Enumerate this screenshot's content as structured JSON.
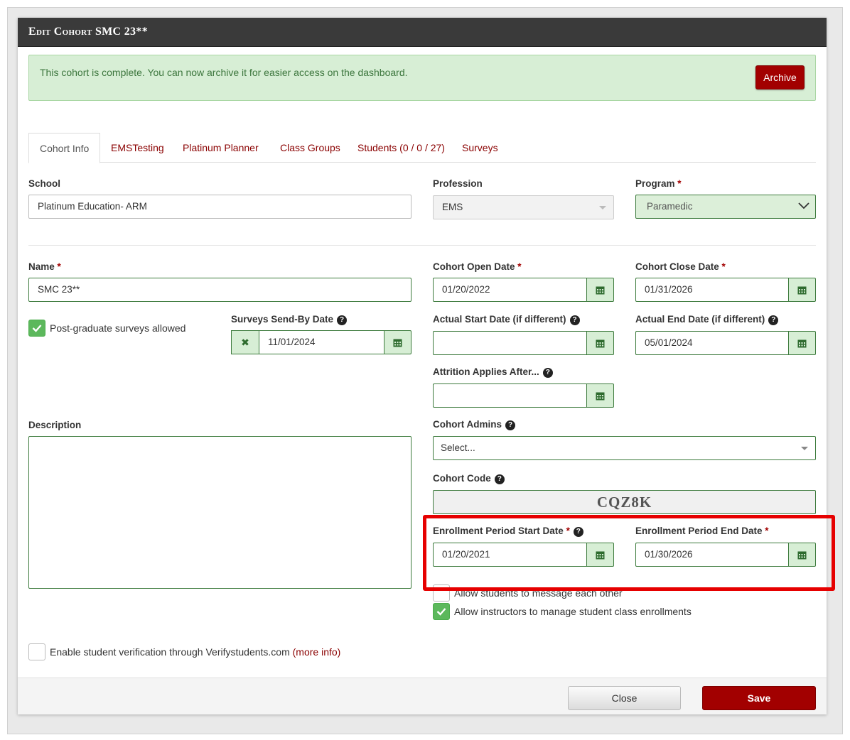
{
  "modal": {
    "title": "Edit Cohort SMC 23**"
  },
  "alert": {
    "message": "This cohort is complete. You can now archive it for easier access on the dashboard.",
    "archive_label": "Archive"
  },
  "tabs": [
    {
      "label": "Cohort Info"
    },
    {
      "label": "EMSTesting"
    },
    {
      "label": "Platinum Planner"
    },
    {
      "label": "Class Groups"
    },
    {
      "label": "Students (0 / 0 / 27)"
    },
    {
      "label": "Surveys"
    }
  ],
  "form": {
    "school_label": "School",
    "school_value": "Platinum Education- ARM",
    "profession_label": "Profession",
    "profession_value": "EMS",
    "program_label": "Program",
    "program_value": "Paramedic",
    "name_label": "Name",
    "name_value": "SMC 23**",
    "post_grad_label": "Post-graduate surveys allowed",
    "surveys_send_by_label": "Surveys Send-By Date",
    "surveys_send_by_value": "11/01/2024",
    "cohort_open_label": "Cohort Open Date",
    "cohort_open_value": "01/20/2022",
    "cohort_close_label": "Cohort Close Date",
    "cohort_close_value": "01/31/2026",
    "actual_start_label": "Actual Start Date (if different)",
    "actual_start_value": "",
    "actual_end_label": "Actual End Date (if different)",
    "actual_end_value": "05/01/2024",
    "attrition_label": "Attrition Applies After...",
    "attrition_value": "",
    "description_label": "Description",
    "cohort_admins_label": "Cohort Admins",
    "cohort_admins_placeholder": "Select...",
    "cohort_code_label": "Cohort Code",
    "cohort_code_value": "CQZ8K",
    "enroll_start_label": "Enrollment Period Start Date",
    "enroll_start_value": "01/20/2021",
    "enroll_end_label": "Enrollment Period End Date",
    "enroll_end_value": "01/30/2026",
    "allow_message_label": "Allow students to message each other",
    "allow_manage_label": "Allow instructors to manage student class enrollments",
    "verify_label": "Enable student verification through Verifystudents.com",
    "verify_link": "(more info)",
    "required_mark": "*",
    "help_mark": "?"
  },
  "footer": {
    "close_label": "Close",
    "save_label": "Save"
  },
  "colors": {
    "brand_red": "#a20000",
    "success_green": "#5cb85c",
    "header_dark": "#3a3a3a"
  }
}
